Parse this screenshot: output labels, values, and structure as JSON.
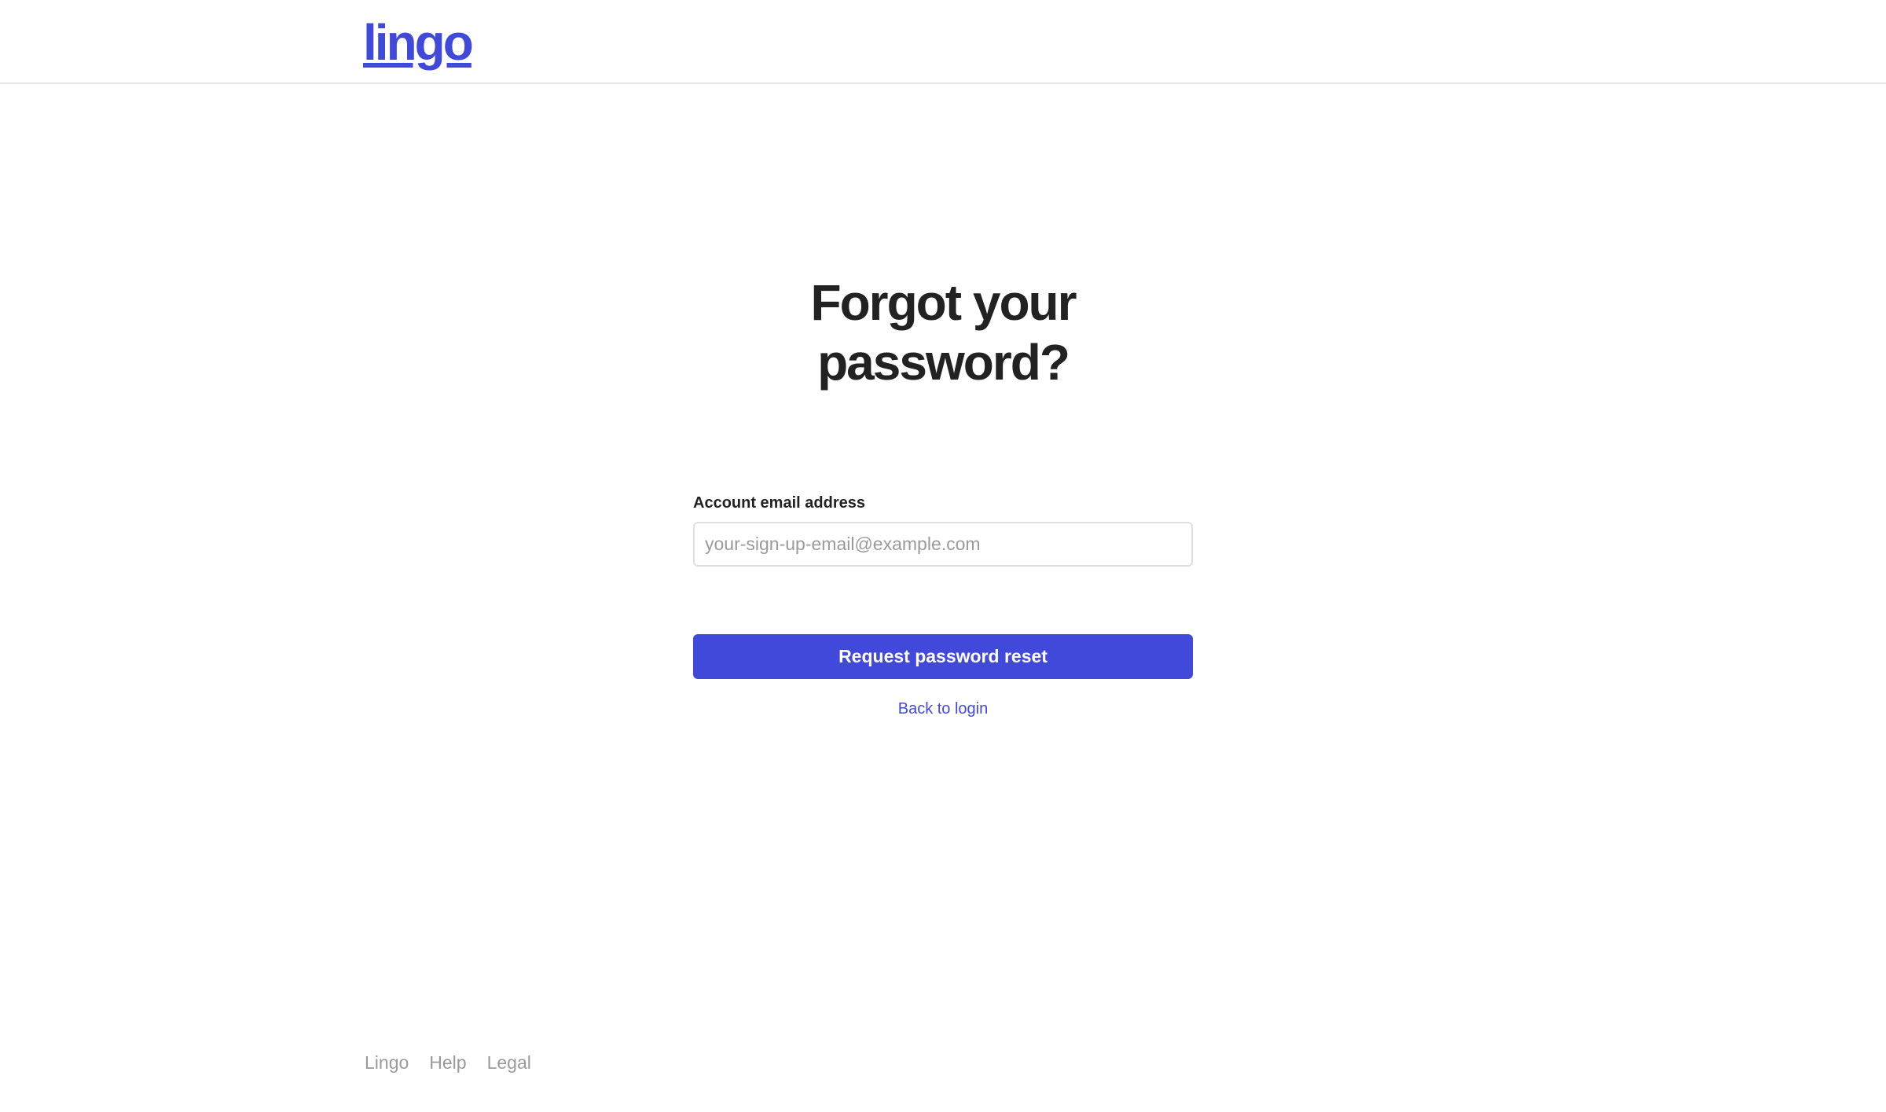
{
  "header": {
    "logo_text": "lingo"
  },
  "main": {
    "title_line1": "Forgot your",
    "title_line2": "password?",
    "form": {
      "email_label": "Account email address",
      "email_value": "",
      "email_placeholder": "your-sign-up-email@example.com",
      "submit_label": "Request password reset",
      "back_link_label": "Back to login"
    }
  },
  "footer": {
    "links": [
      {
        "label": "Lingo"
      },
      {
        "label": "Help"
      },
      {
        "label": "Legal"
      }
    ]
  },
  "colors": {
    "accent": "#4149db",
    "text": "#222222",
    "muted": "#9a9a9a"
  }
}
